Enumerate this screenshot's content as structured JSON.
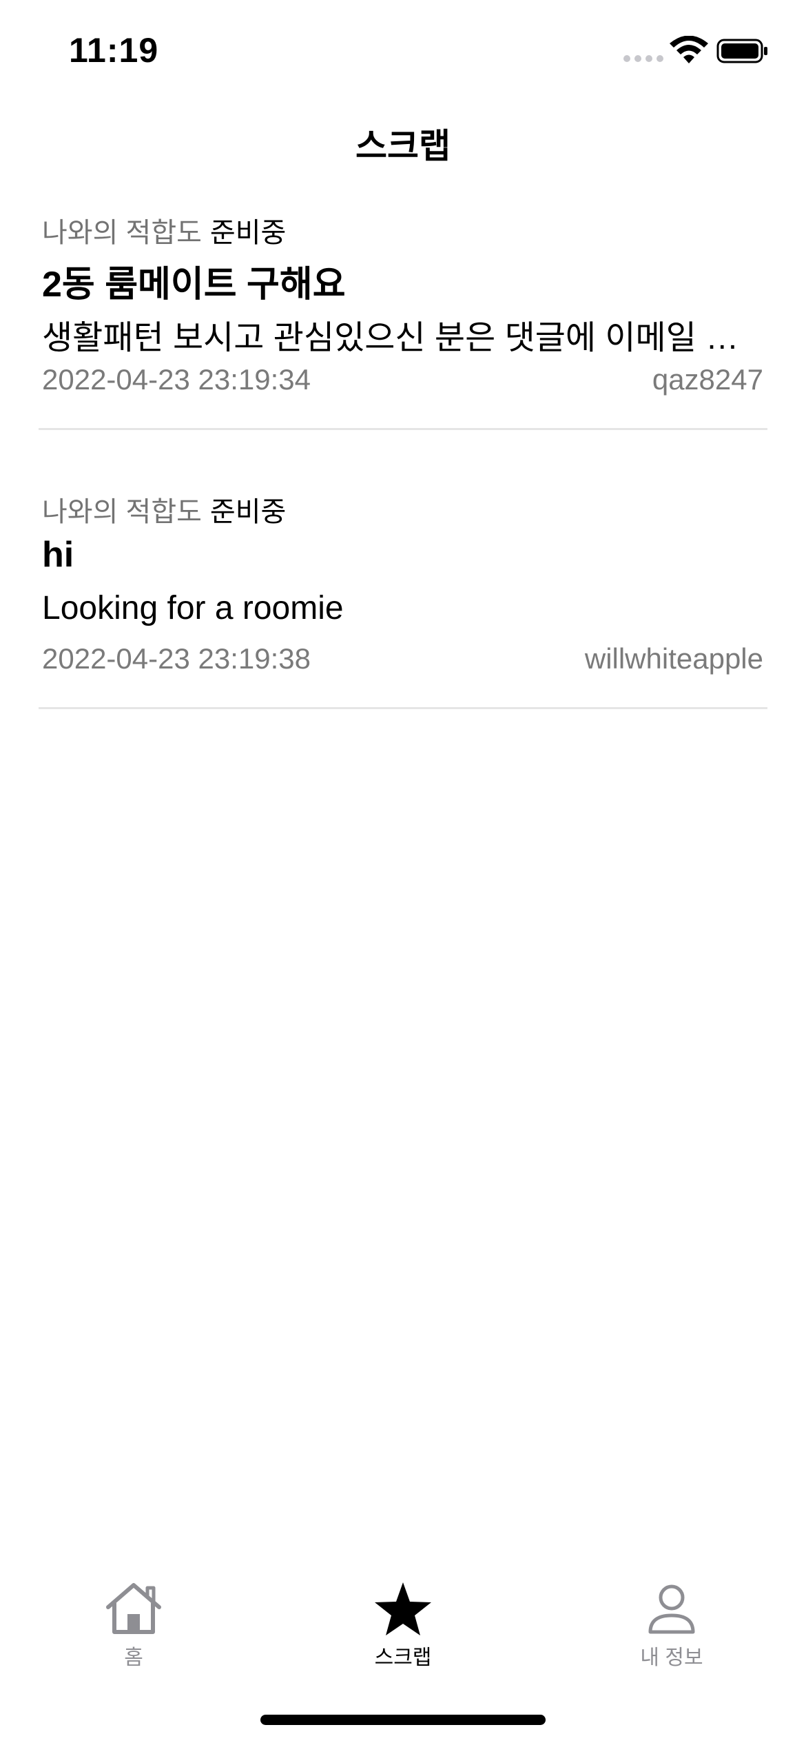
{
  "status_bar": {
    "time": "11:19"
  },
  "nav": {
    "title": "스크랩"
  },
  "posts": [
    {
      "compat_label": "나와의 적합도",
      "compat_value": "준비중",
      "title": "2동 룸메이트 구해요",
      "body": "생활패턴 보시고 관심있으신 분은 댓글에 이메일 남…",
      "date": "2022-04-23 23:19:34",
      "author": "qaz8247"
    },
    {
      "compat_label": "나와의 적합도",
      "compat_value": "준비중",
      "title": "hi",
      "body": "Looking for a roomie",
      "date": "2022-04-23 23:19:38",
      "author": "willwhiteapple"
    }
  ],
  "tabs": [
    {
      "label": "홈",
      "icon": "house-icon"
    },
    {
      "label": "스크랩",
      "icon": "star-icon",
      "selected": true
    },
    {
      "label": "내 정보",
      "icon": "person-icon"
    }
  ],
  "colors": {
    "secondary_text": "#737373",
    "divider": "#e5e5e5",
    "tab_inactive": "#8e8e93",
    "tab_active": "#000000"
  }
}
